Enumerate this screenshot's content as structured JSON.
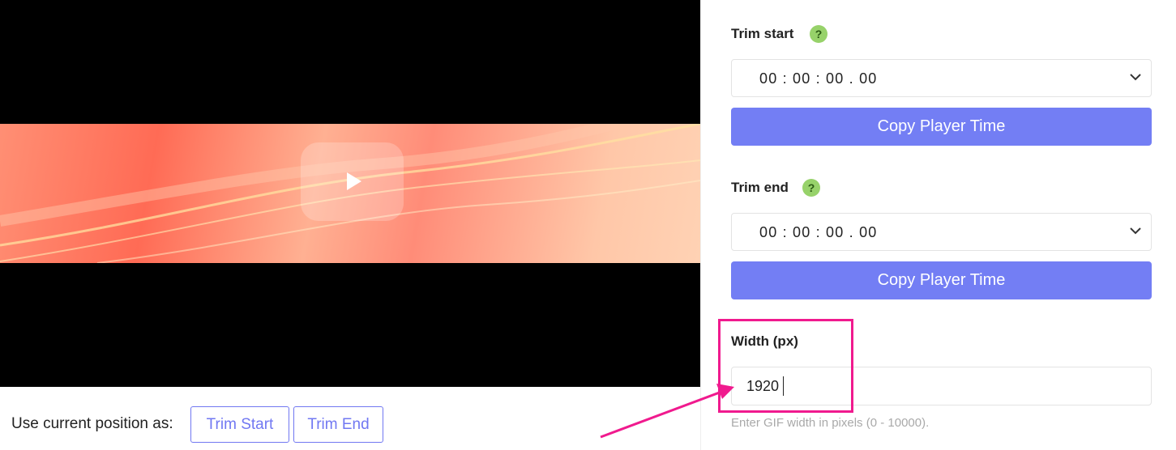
{
  "player": {
    "play_icon": "play-icon"
  },
  "position": {
    "label": "Use current position as:",
    "trim_start_label": "Trim Start",
    "trim_end_label": "Trim End"
  },
  "trim_start": {
    "label": "Trim start",
    "help": "?",
    "time": "00 : 00 : 00 . 00",
    "copy_label": "Copy Player Time"
  },
  "trim_end": {
    "label": "Trim end",
    "help": "?",
    "time": "00 : 00 : 00 . 00",
    "copy_label": "Copy Player Time"
  },
  "width": {
    "label": "Width (px)",
    "value": "1920",
    "hint": "Enter GIF width in pixels (0 - 10000)."
  },
  "colors": {
    "accent": "#737ef4",
    "help_badge": "#97d26a",
    "annotation": "#f01a8e"
  }
}
